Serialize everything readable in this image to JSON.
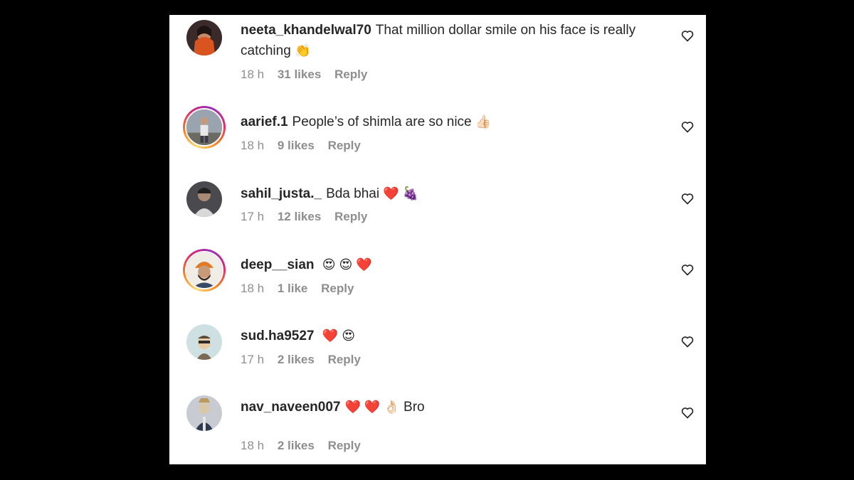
{
  "comments": [
    {
      "username": "neeta_khandelwal70",
      "text": "That million dollar smile on his face is really catching",
      "emojis": "👏",
      "time": "18 h",
      "likes": "31 likes",
      "reply": "Reply"
    },
    {
      "username": "aarief.1",
      "text": "People’s of shimla are so nice",
      "emojis": "👍🏻",
      "time": "18 h",
      "likes": "9 likes",
      "reply": "Reply"
    },
    {
      "username": "sahil_justa._",
      "text": "Bda bhai",
      "emojis": "❤️ 🍇",
      "time": "17 h",
      "likes": "12 likes",
      "reply": "Reply"
    },
    {
      "username": "deep__sian",
      "text": "",
      "emojis": "😍 😍 ❤️",
      "time": "18 h",
      "likes": "1 like",
      "reply": "Reply"
    },
    {
      "username": "sud.ha9527",
      "text": "",
      "emojis": "❤️ 😍",
      "time": "17 h",
      "likes": "2 likes",
      "reply": "Reply"
    },
    {
      "username": "nav_naveen007",
      "text": "Bro",
      "emojis": "❤️ ❤️ 👌🏻",
      "time": "18 h",
      "likes": "2 likes",
      "reply": "Reply"
    }
  ],
  "icons": {
    "like": "heart-outline-icon"
  },
  "colors": {
    "background": "#000000",
    "panel": "#ffffff",
    "text": "#262626",
    "meta": "#8e8e8e"
  }
}
